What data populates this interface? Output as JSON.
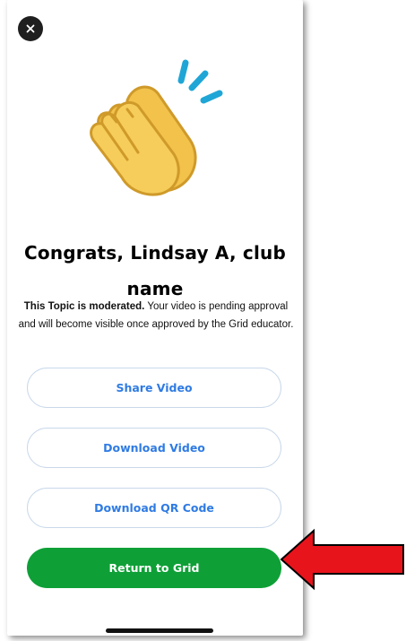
{
  "modal": {
    "close_icon": "close-icon",
    "illustration": "clapping-hands-icon",
    "title": "Congrats, Lindsay A, club name",
    "message_bold": "This Topic is moderated.",
    "message_rest": " Your video is pending approval and will become visible once approved by the Grid educator."
  },
  "buttons": {
    "share": "Share Video",
    "download_video": "Download Video",
    "download_qr": "Download QR Code",
    "return": "Return to Grid"
  },
  "annotation": {
    "arrow_icon": "red-arrow-icon"
  },
  "colors": {
    "primary_green": "#0ea037",
    "link_blue": "#2f7be3",
    "outline_border": "#c9d8ea",
    "annotation_red": "#e8141c"
  }
}
